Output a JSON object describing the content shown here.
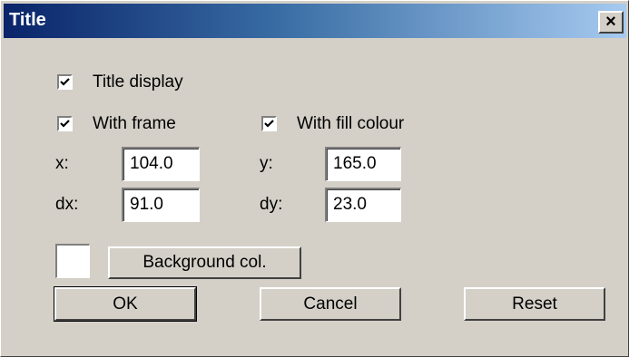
{
  "window": {
    "title": "Title",
    "close_glyph": "×",
    "titlebar_colors": [
      "#0a246a",
      "#a6caf0"
    ]
  },
  "options": {
    "title_display": {
      "label": "Title display",
      "checked": true
    },
    "with_frame": {
      "label": "With frame",
      "checked": true
    },
    "with_fill_colour": {
      "label": "With fill colour",
      "checked": true
    }
  },
  "fields": {
    "x": {
      "label": "x:",
      "value": "104.0"
    },
    "y": {
      "label": "y:",
      "value": "165.0"
    },
    "dx": {
      "label": "dx:",
      "value": "91.0"
    },
    "dy": {
      "label": "dy:",
      "value": "23.0"
    }
  },
  "background": {
    "swatch_color": "#ffffff",
    "button_label": "Background col."
  },
  "buttons": {
    "ok": "OK",
    "cancel": "Cancel",
    "reset": "Reset"
  }
}
